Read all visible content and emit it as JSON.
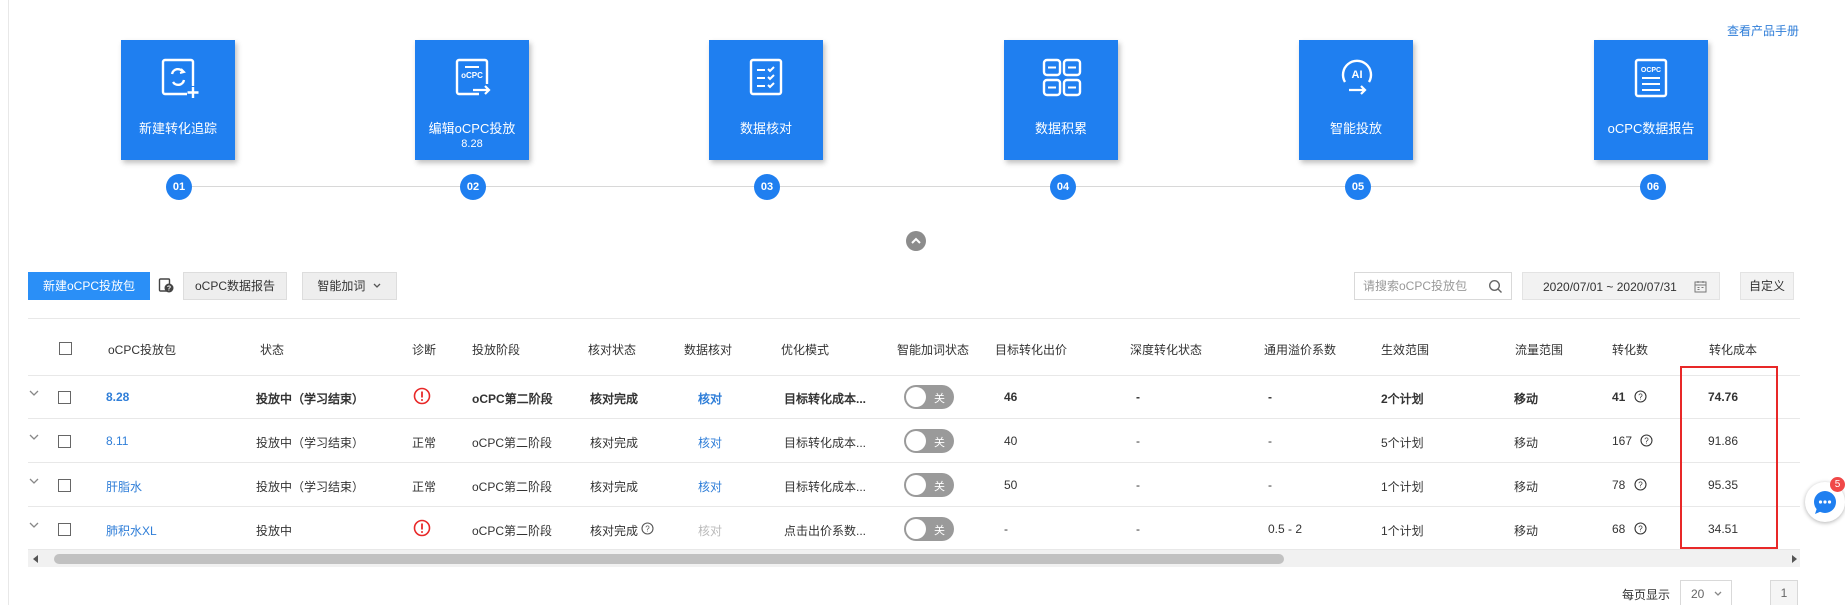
{
  "header": {
    "manual_link": "查看产品手册"
  },
  "steps": [
    {
      "num": "01",
      "label": "新建转化追踪",
      "sub": "",
      "icon": "refresh-plus-icon"
    },
    {
      "num": "02",
      "label": "编辑oCPC投放",
      "sub": "8.28",
      "icon": "ocpc-edit-icon"
    },
    {
      "num": "03",
      "label": "数据核对",
      "sub": "",
      "icon": "checklist-icon"
    },
    {
      "num": "04",
      "label": "数据积累",
      "sub": "",
      "icon": "grid-blocks-icon"
    },
    {
      "num": "05",
      "label": "智能投放",
      "sub": "",
      "icon": "ai-icon"
    },
    {
      "num": "06",
      "label": "oCPC数据报告",
      "sub": "",
      "icon": "ocpc-report-icon",
      "icon_text": "OCPC"
    }
  ],
  "step_icon_text": {
    "ocpc": "oCPC",
    "ai": "AI"
  },
  "toolbar": {
    "new_package": "新建oCPC投放包",
    "report": "oCPC数据报告",
    "smart_bid": "智能加词",
    "search_placeholder": "请搜索oCPC投放包",
    "date_range": "2020/07/01 ~ 2020/07/31",
    "custom": "自定义"
  },
  "table": {
    "columns": [
      "oCPC投放包",
      "状态",
      "诊断",
      "投放阶段",
      "核对状态",
      "数据核对",
      "优化模式",
      "智能加词状态",
      "目标转化出价",
      "深度转化状态",
      "通用溢价系数",
      "生效范围",
      "流量范围",
      "转化数",
      "转化成本"
    ],
    "toggle_label": "关",
    "rows": [
      {
        "name": "8.28",
        "status": "投放中（学习结束）",
        "diagnosis": "",
        "diag_type": "warning",
        "stage": "oCPC第二阶段",
        "check_status": "核对完成",
        "check_help": false,
        "data_check": "核对",
        "data_check_disabled": false,
        "mode": "目标转化成本...",
        "bid": "46",
        "deep": "-",
        "premium": "-",
        "scope": "2个计划",
        "traffic": "移动",
        "conversions": "41",
        "cost": "74.76",
        "bold": true
      },
      {
        "name": "8.11",
        "status": "投放中（学习结束）",
        "diagnosis": "正常",
        "diag_type": "text",
        "stage": "oCPC第二阶段",
        "check_status": "核对完成",
        "check_help": false,
        "data_check": "核对",
        "data_check_disabled": false,
        "mode": "目标转化成本...",
        "bid": "40",
        "deep": "-",
        "premium": "-",
        "scope": "5个计划",
        "traffic": "移动",
        "conversions": "167",
        "cost": "91.86",
        "bold": false
      },
      {
        "name": "肝脂水",
        "status": "投放中（学习结束）",
        "diagnosis": "正常",
        "diag_type": "text",
        "stage": "oCPC第二阶段",
        "check_status": "核对完成",
        "check_help": false,
        "data_check": "核对",
        "data_check_disabled": false,
        "mode": "目标转化成本...",
        "bid": "50",
        "deep": "-",
        "premium": "-",
        "scope": "1个计划",
        "traffic": "移动",
        "conversions": "78",
        "cost": "95.35",
        "bold": false
      },
      {
        "name": "肺积水XL",
        "status": "投放中",
        "diagnosis": "",
        "diag_type": "warning",
        "stage": "oCPC第二阶段",
        "check_status": "核对完成",
        "check_help": true,
        "data_check": "核对",
        "data_check_disabled": true,
        "mode": "点击出价系数...",
        "bid": "-",
        "deep": "-",
        "premium": "0.5 - 2",
        "scope": "1个计划",
        "traffic": "移动",
        "conversions": "68",
        "cost": "34.51",
        "bold": false
      }
    ]
  },
  "pagination": {
    "per_page_label": "每页显示",
    "per_page": "20",
    "current_page": "1"
  },
  "chat": {
    "badge": "5"
  },
  "colors": {
    "primary": "#1f7ff0",
    "link": "#2f7ed8",
    "warning": "#e82828",
    "highlight": "#e82828"
  }
}
